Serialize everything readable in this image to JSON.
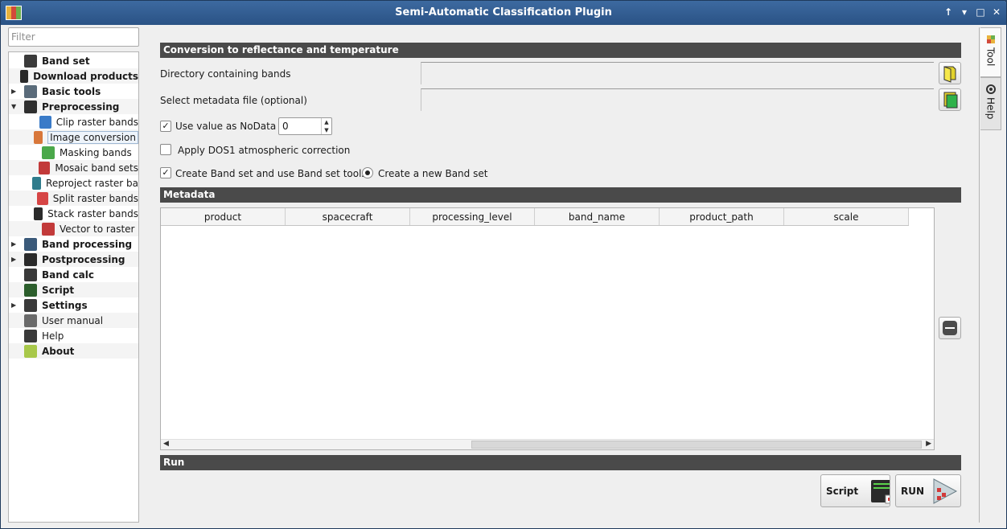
{
  "window": {
    "title": "Semi-Automatic Classification Plugin",
    "controls": [
      "↑",
      "▾",
      "□",
      "✕"
    ]
  },
  "filter": {
    "placeholder": "Filter"
  },
  "tree": {
    "items": [
      {
        "label": "Band set",
        "bold": true,
        "level": 0,
        "expander": "",
        "icon": "band-set-icon"
      },
      {
        "label": "Download products",
        "bold": true,
        "level": 0,
        "expander": "",
        "icon": "download-icon"
      },
      {
        "label": "Basic tools",
        "bold": true,
        "level": 0,
        "expander": "▶",
        "icon": "basic-tools-icon"
      },
      {
        "label": "Preprocessing",
        "bold": true,
        "level": 0,
        "expander": "▼",
        "icon": "preprocessing-icon"
      },
      {
        "label": "Clip raster bands",
        "bold": false,
        "level": 1,
        "expander": "",
        "icon": "clip-icon"
      },
      {
        "label": "Image conversion",
        "bold": false,
        "level": 1,
        "expander": "",
        "icon": "image-conversion-icon",
        "selected": true
      },
      {
        "label": "Masking bands",
        "bold": false,
        "level": 1,
        "expander": "",
        "icon": "masking-icon"
      },
      {
        "label": "Mosaic band sets",
        "bold": false,
        "level": 1,
        "expander": "",
        "icon": "mosaic-icon"
      },
      {
        "label": "Reproject raster ba",
        "bold": false,
        "level": 1,
        "expander": "",
        "icon": "reproject-icon"
      },
      {
        "label": "Split raster bands",
        "bold": false,
        "level": 1,
        "expander": "",
        "icon": "split-icon"
      },
      {
        "label": "Stack raster bands",
        "bold": false,
        "level": 1,
        "expander": "",
        "icon": "stack-icon"
      },
      {
        "label": "Vector to raster",
        "bold": false,
        "level": 1,
        "expander": "",
        "icon": "vector-to-raster-icon"
      },
      {
        "label": "Band processing",
        "bold": true,
        "level": 0,
        "expander": "▶",
        "icon": "band-processing-icon"
      },
      {
        "label": "Postprocessing",
        "bold": true,
        "level": 0,
        "expander": "▶",
        "icon": "postprocessing-icon"
      },
      {
        "label": "Band calc",
        "bold": true,
        "level": 0,
        "expander": "",
        "icon": "band-calc-icon"
      },
      {
        "label": "Script",
        "bold": true,
        "level": 0,
        "expander": "",
        "icon": "script-icon"
      },
      {
        "label": "Settings",
        "bold": true,
        "level": 0,
        "expander": "▶",
        "icon": "settings-icon"
      },
      {
        "label": "User manual",
        "bold": false,
        "level": 0,
        "expander": "",
        "icon": "user-manual-icon"
      },
      {
        "label": "Help",
        "bold": false,
        "level": 0,
        "expander": "",
        "icon": "help-icon"
      },
      {
        "label": "About",
        "bold": true,
        "level": 0,
        "expander": "",
        "icon": "about-icon"
      }
    ]
  },
  "side_tabs": {
    "tool": "Tool",
    "help": "Help"
  },
  "conversion": {
    "section_title": "Conversion to reflectance and temperature",
    "dir_label": "Directory containing bands",
    "metadata_label": "Select metadata file (optional)",
    "nodata_label": "Use value as NoData",
    "nodata_checked": "✓",
    "nodata_value": "0",
    "dos1_label": "Apply DOS1 atmospheric correction",
    "dos1_checked": "",
    "bandset_label": "Create Band set and use Band set tools",
    "bandset_checked": "✓",
    "new_bandset_label": "Create a new Band set"
  },
  "metadata": {
    "section_title": "Metadata",
    "columns": [
      "product",
      "spacecraft",
      "processing_level",
      "band_name",
      "product_path",
      "scale"
    ]
  },
  "run": {
    "section_title": "Run",
    "script_label": "Script",
    "run_label": "RUN"
  }
}
